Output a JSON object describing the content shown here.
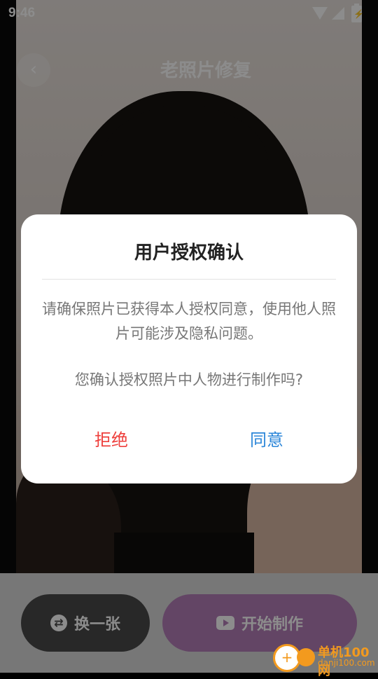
{
  "status_bar": {
    "time": "9:46"
  },
  "header": {
    "back_icon": "chevron-left-icon",
    "title": "老照片修复"
  },
  "bottom": {
    "swap_label": "换一张",
    "swap_icon": "swap-icon",
    "start_label": "开始制作",
    "start_icon": "play-icon"
  },
  "dialog": {
    "title": "用户授权确认",
    "message": "请确保照片已获得本人授权同意，使用他人照片可能涉及隐私问题。",
    "question": "您确认授权照片中人物进行制作吗?",
    "reject_label": "拒绝",
    "agree_label": "同意",
    "reject_color": "#ee3f3c",
    "agree_color": "#2b86d9"
  },
  "watermark": {
    "name": "单机100网",
    "domain": "danji100.com"
  }
}
